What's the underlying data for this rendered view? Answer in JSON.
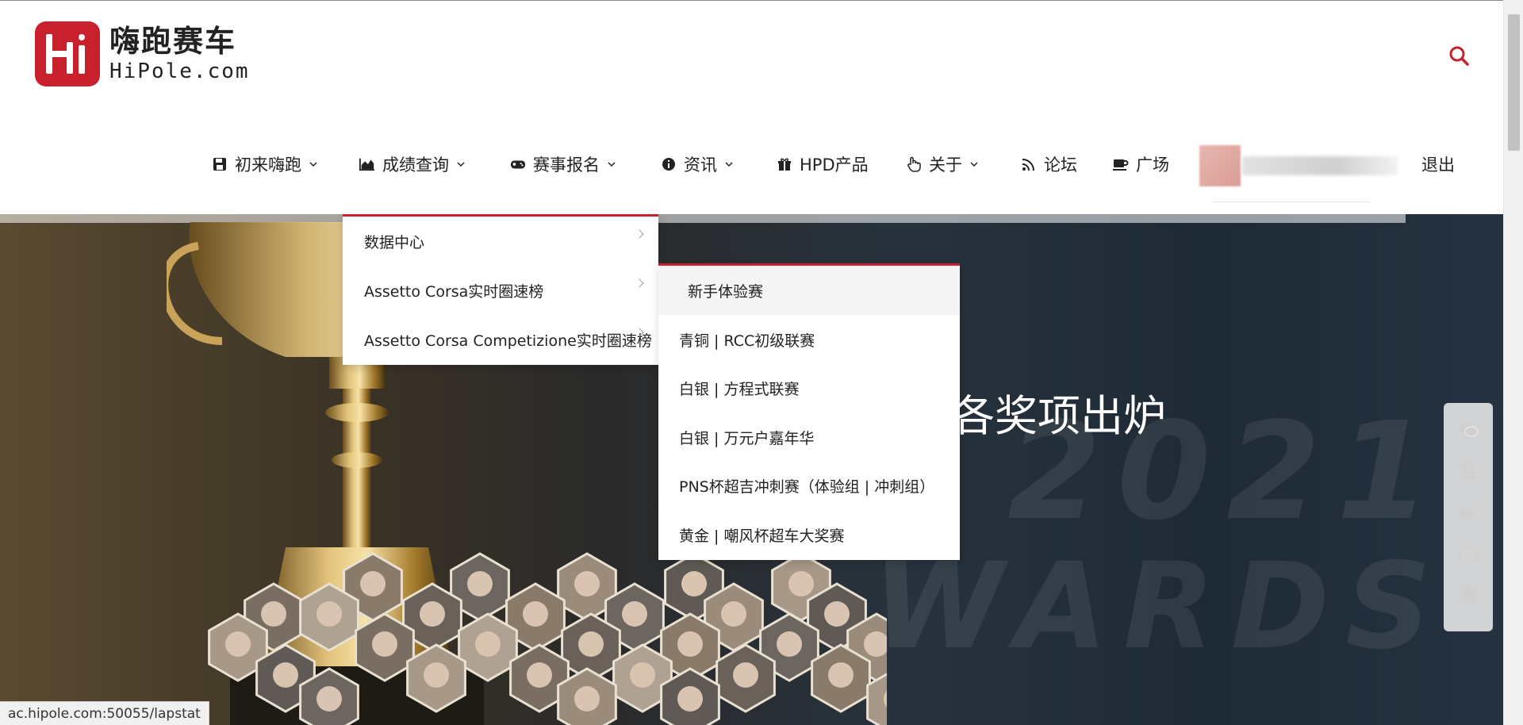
{
  "brand": {
    "name_cn": "嗨跑赛车",
    "name_en": "HiPole.com"
  },
  "nav": {
    "items": [
      {
        "label": "初来嗨跑",
        "icon": "save-icon",
        "has_dropdown": true
      },
      {
        "label": "成绩查询",
        "icon": "area-chart-icon",
        "has_dropdown": true
      },
      {
        "label": "赛事报名",
        "icon": "gamepad-icon",
        "has_dropdown": true
      },
      {
        "label": "资讯",
        "icon": "info-circle-icon",
        "has_dropdown": true
      },
      {
        "label": "HPD产品",
        "icon": "gift-icon",
        "has_dropdown": false
      },
      {
        "label": "关于",
        "icon": "hand-pointer-icon",
        "has_dropdown": true
      },
      {
        "label": "论坛",
        "icon": "feed-icon",
        "has_dropdown": false
      },
      {
        "label": "广场",
        "icon": "coffee-icon",
        "has_dropdown": false
      }
    ],
    "logout": "退出"
  },
  "dropdown_primary": {
    "items": [
      {
        "label": "数据中心"
      },
      {
        "label": "Assetto Corsa实时圈速榜"
      },
      {
        "label": "Assetto Corsa Competizione实时圈速榜"
      }
    ]
  },
  "dropdown_secondary": {
    "items": [
      {
        "label": "新手体验赛"
      },
      {
        "label": "青铜 | RCC初级联赛"
      },
      {
        "label": "白银 | 方程式联赛"
      },
      {
        "label": "白银 | 万元户嘉年华"
      },
      {
        "label": "PNS杯超吉冲刺赛（体验组 | 冲刺组）"
      },
      {
        "label": "黄金 | 嘲风杯超车大奖赛"
      }
    ]
  },
  "hero": {
    "title": "各奖项出炉",
    "bg_text_1": "2021",
    "bg_text_2": "WARDS"
  },
  "social": {
    "icons": [
      "wechat-icon",
      "qq-icon",
      "weibo-icon",
      "bilibili-icon",
      "taobao-icon"
    ],
    "taobao_label": "淘"
  },
  "status_bar": {
    "url": "ac.hipole.com:50055/lapstat"
  },
  "colors": {
    "accent": "#c8202c",
    "text": "#222222"
  }
}
